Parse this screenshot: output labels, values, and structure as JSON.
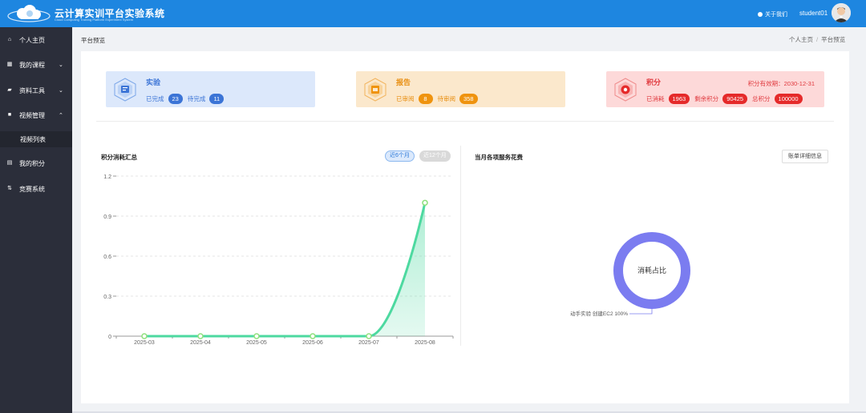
{
  "header": {
    "title": "云计算实训平台实验系统",
    "subtitle": "Cloud Computing Training Platform Experiment System",
    "about_label": "关于我们",
    "username": "student01"
  },
  "sidebar": {
    "items": [
      {
        "label": "个人主页",
        "icon": "home-icon"
      },
      {
        "label": "我的课程",
        "icon": "grid-icon"
      },
      {
        "label": "资料工具",
        "icon": "folder-icon"
      },
      {
        "label": "视频管理",
        "icon": "video-icon"
      },
      {
        "label": "视频列表",
        "icon": ""
      },
      {
        "label": "我的积分",
        "icon": "database-icon"
      },
      {
        "label": "竞赛系统",
        "icon": "sort-icon"
      }
    ]
  },
  "breadcrumb": {
    "page": "平台预览",
    "home": "个人主页",
    "sep": "/",
    "current": "平台预览"
  },
  "cards": {
    "experiment": {
      "title": "实验",
      "done_label": "已完成",
      "done": "23",
      "todo_label": "待完成",
      "todo": "11"
    },
    "report": {
      "title": "报告",
      "reviewed_label": "已审阅",
      "reviewed": "8",
      "pending_label": "待审阅",
      "pending": "358"
    },
    "points": {
      "title": "积分",
      "valid_label": "积分有效期：2030-12-31",
      "used_label": "已消耗",
      "used": "1963",
      "remain_label": "剩余积分",
      "remain": "90425",
      "total_label": "总积分",
      "total": "100000"
    }
  },
  "usage_chart": {
    "title": "积分消耗汇总",
    "tab_active": "近6个月",
    "tab_idle": "近12个月"
  },
  "service_chart": {
    "title": "当月各项服务花费",
    "bill_button": "账单详细信息"
  },
  "colors": {
    "brand": "#1e86e0",
    "sidebar": "#2b2e3a",
    "line": "#4dd9a0",
    "donut": "#7b7cf0"
  },
  "chart_data": [
    {
      "type": "area",
      "categories": [
        "2025-03",
        "2025-04",
        "2025-05",
        "2025-06",
        "2025-07",
        "2025-08"
      ],
      "values": [
        0,
        0,
        0,
        0,
        0,
        1
      ],
      "ylim": [
        0,
        1.2
      ],
      "yticks": [
        "0",
        "0.3",
        "0.6",
        "0.9",
        "1.2"
      ],
      "grid": true
    },
    {
      "type": "pie",
      "center_label": "消耗占比",
      "slices": [
        {
          "label": "动手实验 创建EC2 100%",
          "value": 100
        }
      ]
    }
  ]
}
